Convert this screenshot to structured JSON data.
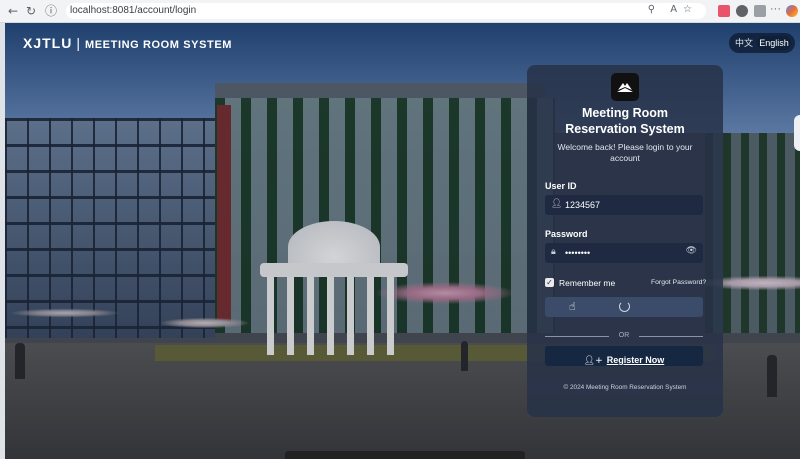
{
  "browser": {
    "url": "localhost:8081/account/login",
    "back_icon": "arrow-left-icon",
    "forward_icon": "arrow-right-icon",
    "reload_icon": "reload-icon",
    "lock_icon": "info-icon"
  },
  "header": {
    "brand": "XJTLU",
    "separator": "|",
    "system_name": "MEETING ROOM SYSTEM"
  },
  "language": {
    "chinese": "中文",
    "english": "English",
    "selected": "English"
  },
  "login_card": {
    "title_line1": "Meeting Room",
    "title_line2": "Reservation System",
    "welcome": "Welcome back! Please login to your account",
    "user_id_label": "User ID",
    "user_id_value": "1234567",
    "password_label": "Password",
    "password_value": "••••••••",
    "remember_label": "Remember me",
    "remember_checked": true,
    "forgot_label": "Forgot Password?",
    "login_state": "loading",
    "or_label": "OR",
    "register_label": "Register Now",
    "copyright": "© 2024 Meeting Room Reservation System"
  },
  "colors": {
    "card_bg": "#28324a",
    "field_bg": "#1f2a42",
    "register_bg": "#162741",
    "login_btn_bg": "#3b4b6a"
  }
}
